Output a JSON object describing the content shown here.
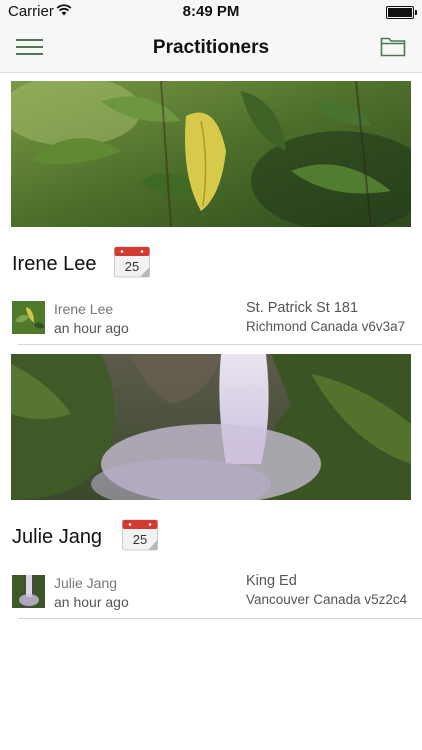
{
  "status_bar": {
    "carrier": "Carrier",
    "time": "8:49 PM"
  },
  "nav": {
    "title": "Practitioners"
  },
  "practitioners": [
    {
      "name": "Irene Lee",
      "calendar_day": "25",
      "author": "Irene Lee",
      "posted": "an hour ago",
      "address_line1": "St. Patrick St 181",
      "address_line2": "Richmond Canada v6v3a7"
    },
    {
      "name": "Julie Jang",
      "calendar_day": "25",
      "author": "Julie Jang",
      "posted": "an hour ago",
      "address_line1": "King Ed",
      "address_line2": "Vancouver Canada v5z2c4"
    }
  ]
}
